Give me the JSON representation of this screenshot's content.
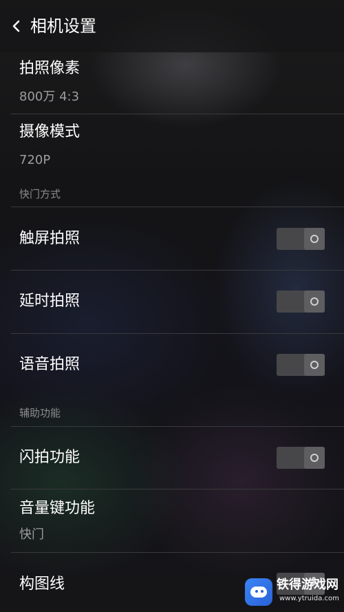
{
  "header": {
    "back_icon": "chevron-left-icon",
    "title": "相机设置"
  },
  "settings": {
    "photo_resolution": {
      "label": "拍照像素",
      "value": "800万 4:3"
    },
    "video_mode": {
      "label": "摄像模式",
      "value": "720P"
    },
    "shutter_section": "快门方式",
    "touch_capture": {
      "label": "触屏拍照",
      "enabled": false
    },
    "timer_capture": {
      "label": "延时拍照",
      "enabled": false
    },
    "voice_capture": {
      "label": "语音拍照",
      "enabled": false
    },
    "assist_section": "辅助功能",
    "flash_capture": {
      "label": "闪拍功能",
      "enabled": false
    },
    "volume_key": {
      "label": "音量键功能",
      "value": "快门"
    },
    "grid_lines": {
      "label": "构图线"
    }
  },
  "watermark": {
    "text": "铁得游戏网",
    "url": "www.ytruida.com"
  },
  "colors": {
    "background": "#161617",
    "text_primary": "#ffffff",
    "text_secondary": "#9d9d9f",
    "divider": "#3a3a3c",
    "toggle_off": "#47474a"
  }
}
